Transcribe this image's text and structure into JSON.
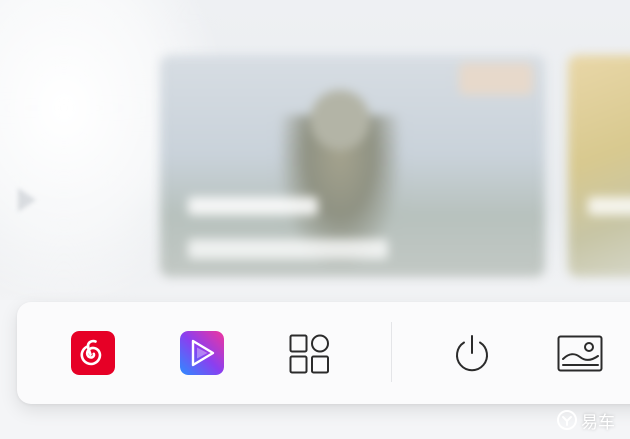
{
  "dock": {
    "items": [
      {
        "id": "netease-music",
        "icon": "netease-cloud-music-icon",
        "color": "#e60026"
      },
      {
        "id": "video-app",
        "icon": "video-play-icon",
        "color": "#7b3fe4"
      },
      {
        "id": "apps-grid",
        "icon": "apps-grid-icon"
      },
      {
        "id": "power",
        "icon": "power-icon"
      },
      {
        "id": "wallpaper",
        "icon": "picture-icon"
      }
    ]
  },
  "watermark": {
    "text": "易车",
    "icon": "yiche-logo-icon"
  }
}
